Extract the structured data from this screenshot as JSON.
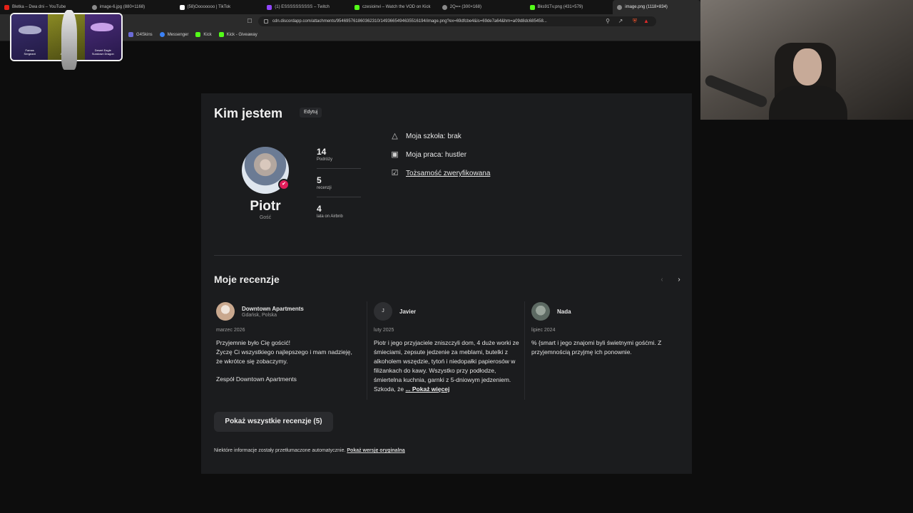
{
  "tabs": [
    {
      "title": "Bletka – Dwa dni – YouTube",
      "color": "#e62117"
    },
    {
      "title": "image-6.jpg (880×1168)",
      "color": "#8a8a8a"
    },
    {
      "title": "(58)Oooooooo | TikTok",
      "color": "#ffffff"
    },
    {
      "title": "(1) ESSSSSSSSSS – Twitch",
      "color": "#9146ff"
    },
    {
      "title": "czesioinvi – Watch the VOD on Kick",
      "color": "#53fc18"
    },
    {
      "title": "2Q== (300×168)",
      "color": "#8a8a8a"
    },
    {
      "title": "Bks91Tv.png (431×579)",
      "color": "#53fc18"
    },
    {
      "title": "image.png (1118×834)",
      "color": "#8a8a8a"
    }
  ],
  "url": "cdn.discordapp.com/attachments/954695761860362310/1493665494635516194/image.png?ex=69dfcbe4&is=69de7a64&hm=a09d8dc685458...",
  "bookmarks": [
    {
      "label": "G4Skins",
      "color": "#6b6bd6"
    },
    {
      "label": "Messenger",
      "color": "#3b82f6"
    },
    {
      "label": "Kick",
      "color": "#53fc18"
    },
    {
      "label": "Kick - Giveaway",
      "color": "#53fc18"
    }
  ],
  "overlay": {
    "labels": [
      "Famas\nSergeant",
      "A Barrel\nAttractive",
      "Desert Eagle\nSundown Dragon"
    ]
  },
  "profile": {
    "heading": "Kim jestem",
    "edit_label": "Edytuj",
    "name": "Piotr",
    "role": "Gość",
    "stats": [
      {
        "value": "14",
        "label": "Podróży"
      },
      {
        "value": "5",
        "label": "recenzji"
      },
      {
        "value": "4",
        "label": "lata on Airbnb"
      }
    ],
    "info": [
      {
        "icon": "graduation-cap-icon",
        "text": "Moja szkoła: brak"
      },
      {
        "icon": "briefcase-icon",
        "text": "Moja praca: hustler"
      },
      {
        "icon": "shield-check-icon",
        "text": "Tożsamość zweryfikowana"
      }
    ]
  },
  "reviews": {
    "heading": "Moje recenzje",
    "items": [
      {
        "name": "Downtown Apartments",
        "location": "Gdańsk, Polska",
        "date": "marzec 2026",
        "avatar_initial": "",
        "avatar_color": "#d8c2ae",
        "text": "Przyjemnie było Cię gościć!\nŻyczę Ci wszystkiego najlepszego i mam nadzieję, że wkrótce się zobaczymy.",
        "signature": "Zespół Downtown Apartments"
      },
      {
        "name": "Javier",
        "location": "",
        "date": "luty 2025",
        "avatar_initial": "J",
        "avatar_color": "#2e2f32",
        "text": "Piotr i jego przyjaciele zniszczyli dom, 4 duże worki ze śmieciami, zepsute jedzenie za meblami, butelki z alkoholem wszędzie, tytoń i niedopałki papierosów w filiżankach do kawy. Wszystko przy podłodze, śmiertelna kuchnia, garnki z 5-dniowym jedzeniem. Szkoda, że",
        "more_label": "... Pokaż więcej"
      },
      {
        "name": "Nada",
        "location": "",
        "date": "lipiec 2024",
        "avatar_initial": "",
        "avatar_color": "#6f7a73",
        "text": "% {smart i jego znajomi byli świetnymi gośćmi.  Z przyjemnością przyjmę ich ponownie."
      }
    ],
    "show_all_label": "Pokaż wszystkie recenzje (5)",
    "translation_note": "Niektóre informacje zostały przetłumaczone automatycznie.",
    "show_original_label": "Pokaż wersję oryginalną"
  }
}
